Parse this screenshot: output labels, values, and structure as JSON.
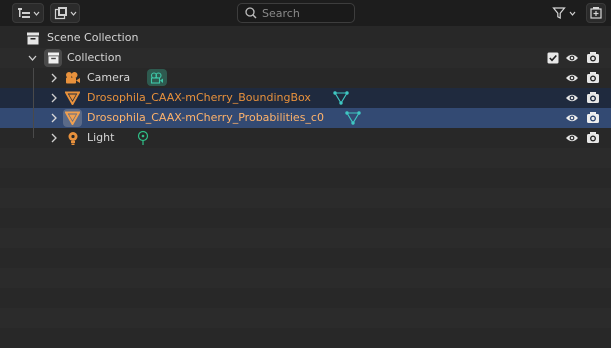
{
  "header": {
    "display_mode_icon": "outliner-display-mode-icon",
    "view_layer_icon": "view-layer-icon",
    "search": {
      "placeholder": "Search",
      "value": ""
    },
    "filter_icon": "filter-funnel-icon",
    "new_collection_icon": "new-collection-icon"
  },
  "tree": {
    "scene_collection": "Scene Collection",
    "collection": "Collection",
    "items": [
      {
        "label": "Camera",
        "kind": "camera",
        "data_icon": "camera-data-icon"
      },
      {
        "label": "Drosophila_CAAX-mCherry_BoundingBox",
        "kind": "mesh",
        "data_icon": "mesh-data-icon"
      },
      {
        "label": "Drosophila_CAAX-mCherry_Probabilities_c0",
        "kind": "mesh",
        "data_icon": "mesh-data-icon"
      },
      {
        "label": "Light",
        "kind": "light",
        "data_icon": "light-data-icon"
      }
    ]
  },
  "colors": {
    "background": "#282828",
    "alt_row": "#2b2b2b",
    "selected_row": "#334a73",
    "highlight_row": "#1f2a3e",
    "mesh_label": "#e8913c",
    "accent_cyan": "#3fc7c2",
    "accent_green": "#2fbf87"
  }
}
